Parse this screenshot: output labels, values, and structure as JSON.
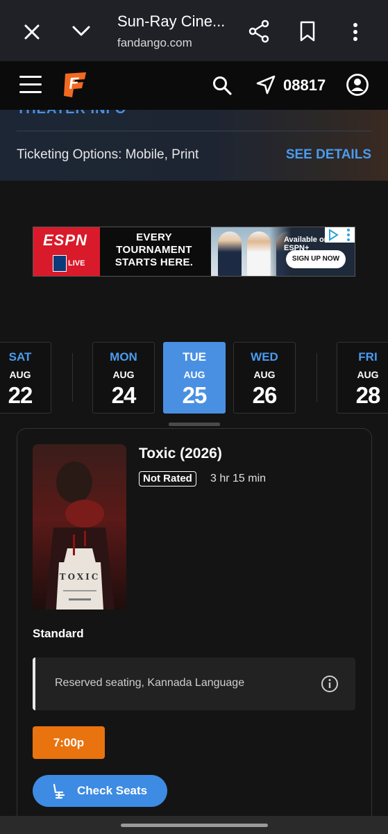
{
  "browser": {
    "page_title": "Sun-Ray Cine...",
    "domain": "fandango.com"
  },
  "header": {
    "zip_code": "08817"
  },
  "theater_info": {
    "section_label": "THEATER INFO",
    "ticketing_options": "Ticketing Options: Mobile, Print",
    "see_details": "SEE DETAILS"
  },
  "ad": {
    "brand": "ESPN",
    "live_label": "LIVE",
    "headline_line1": "EVERY",
    "headline_line2": "TOURNAMENT",
    "headline_line3": "STARTS HERE.",
    "available_text": "Available on ESPN+",
    "cta": "SIGN UP NOW"
  },
  "dates": [
    {
      "dow": "SAT",
      "month": "AUG",
      "day": "22",
      "selected": false
    },
    {
      "dow": "MON",
      "month": "AUG",
      "day": "24",
      "selected": false
    },
    {
      "dow": "TUE",
      "month": "AUG",
      "day": "25",
      "selected": true
    },
    {
      "dow": "WED",
      "month": "AUG",
      "day": "26",
      "selected": false
    },
    {
      "dow": "FRI",
      "month": "AUG",
      "day": "28",
      "selected": false
    }
  ],
  "movie": {
    "title": "Toxic (2026)",
    "rating": "Not Rated",
    "runtime": "3 hr 15 min",
    "poster_text": "TOXIC",
    "format": "Standard",
    "amenities": "Reserved seating, Kannada Language",
    "showtime": "7:00p",
    "check_seats": "Check Seats"
  },
  "colors": {
    "accent_blue": "#4a90e2",
    "showtime_orange": "#e8730f",
    "fandango_orange": "#f26a21"
  }
}
